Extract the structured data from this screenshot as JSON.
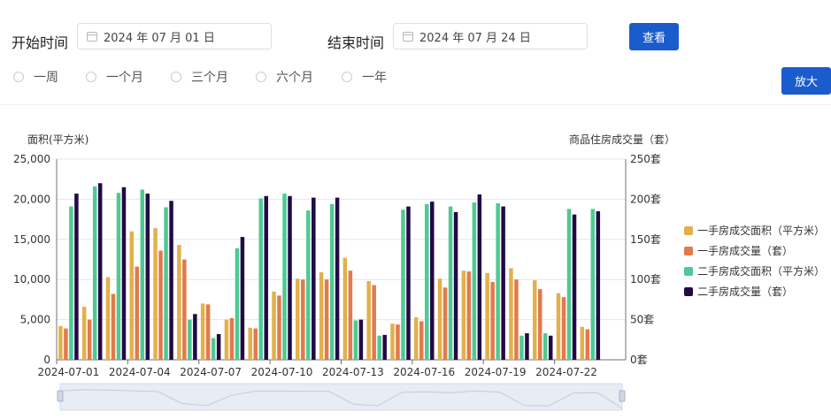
{
  "filters": {
    "start_label": "开始时间",
    "start_value": "2024 年 07 月 01 日",
    "end_label": "结束时间",
    "end_value": "2024 年 07 月 24 日",
    "query_button": "查看",
    "zoom_button": "放大",
    "ranges": [
      "一周",
      "一个月",
      "三个月",
      "六个月",
      "一年"
    ]
  },
  "colors": {
    "accent": "#1a5ccc",
    "series": [
      "#e3b04b",
      "#e07b4c",
      "#4fc994",
      "#220a46"
    ]
  },
  "chart_data": {
    "type": "bar",
    "ylabel_left": "面积(平方米)",
    "ylabel_right": "商品住房成交量（套）",
    "y_left_range": [
      0,
      25000
    ],
    "y_right_range": [
      0,
      250
    ],
    "y_left_ticks": [
      "0",
      "5,000",
      "10,000",
      "15,000",
      "20,000",
      "25,000"
    ],
    "y_right_ticks": [
      "0套",
      "50套",
      "100套",
      "150套",
      "200套",
      "250套"
    ],
    "grid": true,
    "legend_position": "right",
    "categories": [
      "2024-07-01",
      "2024-07-02",
      "2024-07-03",
      "2024-07-04",
      "2024-07-05",
      "2024-07-06",
      "2024-07-07",
      "2024-07-08",
      "2024-07-09",
      "2024-07-10",
      "2024-07-11",
      "2024-07-12",
      "2024-07-13",
      "2024-07-14",
      "2024-07-15",
      "2024-07-16",
      "2024-07-17",
      "2024-07-18",
      "2024-07-19",
      "2024-07-20",
      "2024-07-21",
      "2024-07-22",
      "2024-07-23",
      "2024-07-24"
    ],
    "x_tick_labels": [
      "2024-07-01",
      "2024-07-04",
      "2024-07-07",
      "2024-07-10",
      "2024-07-13",
      "2024-07-16",
      "2024-07-19",
      "2024-07-22"
    ],
    "series": [
      {
        "name": "一手房成交面积（平方米）",
        "axis": "left",
        "values": [
          4200,
          6600,
          10300,
          16000,
          16400,
          14300,
          7000,
          5000,
          4000,
          8500,
          10100,
          10900,
          12700,
          9800,
          4500,
          5300,
          10100,
          11100,
          10800,
          11400,
          9900,
          8300,
          4100,
          0
        ]
      },
      {
        "name": "一手房成交量（套）",
        "axis": "right",
        "values": [
          39,
          50,
          82,
          116,
          136,
          125,
          69,
          52,
          39,
          80,
          100,
          100,
          111,
          93,
          44,
          48,
          90,
          110,
          97,
          100,
          88,
          78,
          38,
          0
        ]
      },
      {
        "name": "二手房成交面积（平方米）",
        "axis": "left",
        "values": [
          19100,
          21600,
          20800,
          21200,
          19000,
          5000,
          2700,
          13900,
          20100,
          20700,
          18600,
          19400,
          4900,
          3000,
          18700,
          19400,
          19100,
          19600,
          19500,
          3000,
          3300,
          18800,
          18800,
          0
        ]
      },
      {
        "name": "二手房成交量（套）",
        "axis": "right",
        "values": [
          207,
          220,
          215,
          207,
          198,
          57,
          32,
          153,
          204,
          204,
          202,
          202,
          50,
          31,
          191,
          197,
          184,
          206,
          191,
          33,
          30,
          181,
          185,
          0
        ]
      }
    ]
  }
}
